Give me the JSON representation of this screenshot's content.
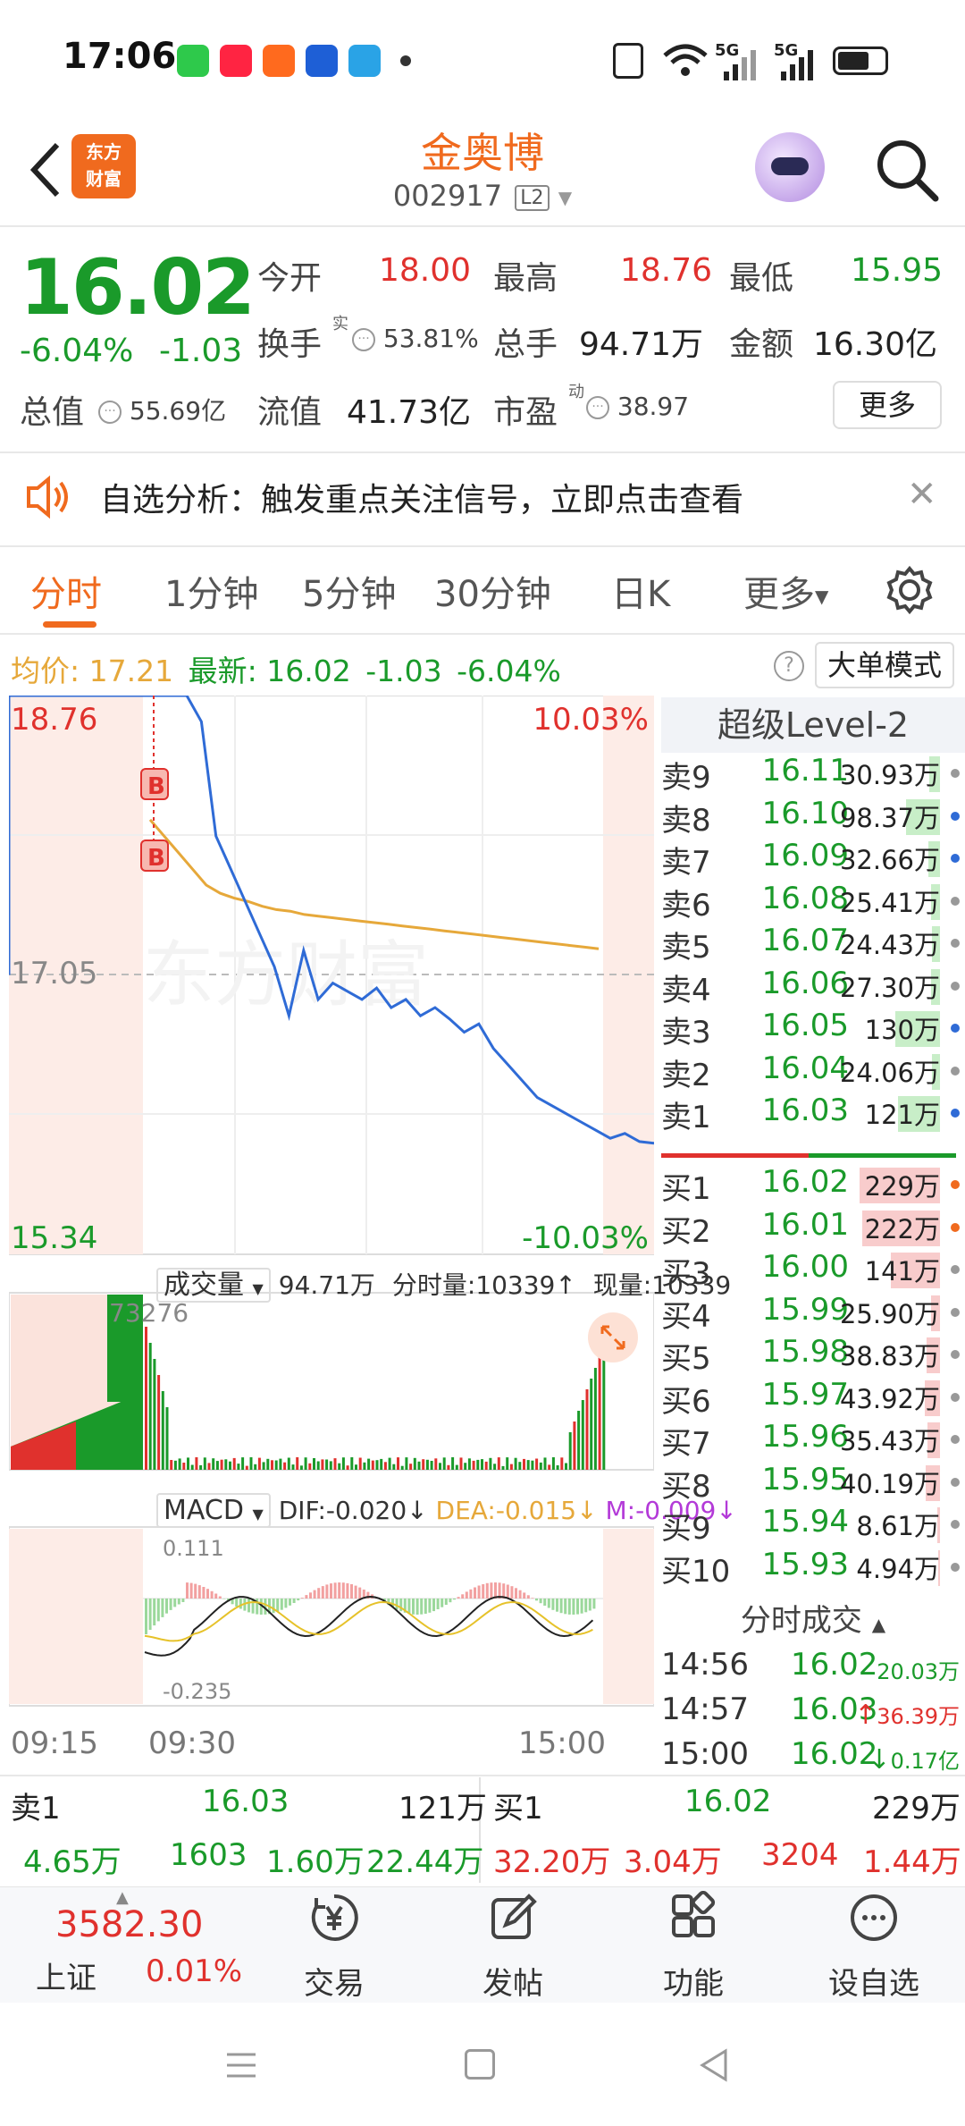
{
  "status_bar": {
    "time": "17:06",
    "network": "5G"
  },
  "header": {
    "back": "back",
    "logo_line1": "东方",
    "logo_line2": "财富",
    "stock_name": "金奥博",
    "stock_code": "002917",
    "level_badge": "L2"
  },
  "quote": {
    "price": "16.02",
    "change_pct": "-6.04%",
    "change_abs": "-1.03",
    "open_label": "今开",
    "open": "18.00",
    "high_label": "最高",
    "high": "18.76",
    "low_label": "最低",
    "low": "15.95",
    "turnover_label": "换手",
    "turnover_sup": "实",
    "turnover": "53.81%",
    "volume_label": "总手",
    "volume": "94.71万",
    "amount_label": "金额",
    "amount": "16.30亿",
    "mktcap_label": "总值",
    "mktcap": "55.69亿",
    "float_label": "流值",
    "float_cap": "41.73亿",
    "pe_label": "市盈",
    "pe_sup": "动",
    "pe": "38.97",
    "more_label": "更多"
  },
  "alert": {
    "text": "自选分析：触发重点关注信号，立即点击查看"
  },
  "tabs": [
    {
      "label": "分时"
    },
    {
      "label": "1分钟"
    },
    {
      "label": "5分钟"
    },
    {
      "label": "30分钟"
    },
    {
      "label": "日K"
    },
    {
      "label": "更多"
    }
  ],
  "avg_line": {
    "avg_label": "均价:",
    "avg": "17.21",
    "latest_label": "最新:",
    "latest": "16.02",
    "chg": "-1.03",
    "pct": "-6.04%",
    "big_order_mode": "大单模式"
  },
  "chart_data": {
    "type": "line",
    "price_top": "18.76",
    "price_mid": "17.05",
    "price_bottom": "15.34",
    "pct_top": "10.03%",
    "pct_bottom": "-10.03%",
    "ylim": [
      15.34,
      18.76
    ],
    "markers": [
      "B",
      "B"
    ],
    "price_series": [
      18.76,
      18.76,
      18.76,
      18.76,
      18.6,
      17.9,
      17.7,
      17.5,
      17.3,
      17.1,
      16.8,
      17.2,
      16.9,
      17.0,
      16.95,
      16.9,
      16.97,
      16.85,
      16.9,
      16.8,
      16.85,
      16.78,
      16.7,
      16.75,
      16.6,
      16.5,
      16.4,
      16.3,
      16.25,
      16.2,
      16.15,
      16.1,
      16.05,
      16.08,
      16.03,
      16.02
    ],
    "avg_series": [
      18.0,
      17.9,
      17.8,
      17.7,
      17.6,
      17.55,
      17.52,
      17.5,
      17.47,
      17.45,
      17.44,
      17.42,
      17.41,
      17.4,
      17.39,
      17.38,
      17.37,
      17.36,
      17.35,
      17.34,
      17.33,
      17.32,
      17.31,
      17.3,
      17.29,
      17.28,
      17.27,
      17.26,
      17.25,
      17.24,
      17.23,
      17.22,
      17.21
    ],
    "volume": {
      "label": "成交量",
      "total": "94.71万",
      "tick_label": "分时量:10339↑",
      "current_label": "现量:10339",
      "max_label": "73276"
    },
    "macd": {
      "label": "MACD",
      "dif": "DIF:-0.020↓",
      "dea": "DEA:-0.015↓",
      "m": "M:-0.009↓",
      "top": "0.111",
      "bottom": "-0.235"
    },
    "time_labels": [
      "09:15",
      "09:30",
      "15:00"
    ]
  },
  "order_book": {
    "title": "超级Level-2",
    "asks": [
      {
        "label": "卖9",
        "price": "16.11",
        "vol": "30.93万",
        "bar": 0.12,
        "dot": "#999"
      },
      {
        "label": "卖8",
        "price": "16.10",
        "vol": "98.37万",
        "bar": 0.38,
        "dot": "#2f6bd6"
      },
      {
        "label": "卖7",
        "price": "16.09",
        "vol": "32.66万",
        "bar": 0.13,
        "dot": "#2f6bd6"
      },
      {
        "label": "卖6",
        "price": "16.08",
        "vol": "25.41万",
        "bar": 0.1,
        "dot": "#999"
      },
      {
        "label": "卖5",
        "price": "16.07",
        "vol": "24.43万",
        "bar": 0.09,
        "dot": "#999"
      },
      {
        "label": "卖4",
        "price": "16.06",
        "vol": "27.30万",
        "bar": 0.1,
        "dot": "#999"
      },
      {
        "label": "卖3",
        "price": "16.05",
        "vol": "130万",
        "bar": 0.5,
        "dot": "#2f6bd6"
      },
      {
        "label": "卖2",
        "price": "16.04",
        "vol": "24.06万",
        "bar": 0.09,
        "dot": "#999"
      },
      {
        "label": "卖1",
        "price": "16.03",
        "vol": "121万",
        "bar": 0.47,
        "dot": "#2f6bd6"
      }
    ],
    "bids": [
      {
        "label": "买1",
        "price": "16.02",
        "vol": "229万",
        "bar": 0.9,
        "dot": "#f06a1e"
      },
      {
        "label": "买2",
        "price": "16.01",
        "vol": "222万",
        "bar": 0.87,
        "dot": "#f06a1e"
      },
      {
        "label": "买3",
        "price": "16.00",
        "vol": "141万",
        "bar": 0.55,
        "dot": "#999"
      },
      {
        "label": "买4",
        "price": "15.99",
        "vol": "25.90万",
        "bar": 0.1,
        "dot": "#999"
      },
      {
        "label": "买5",
        "price": "15.98",
        "vol": "38.83万",
        "bar": 0.15,
        "dot": "#999"
      },
      {
        "label": "买6",
        "price": "15.97",
        "vol": "43.92万",
        "bar": 0.17,
        "dot": "#999"
      },
      {
        "label": "买7",
        "price": "15.96",
        "vol": "35.43万",
        "bar": 0.14,
        "dot": "#999"
      },
      {
        "label": "买8",
        "price": "15.95",
        "vol": "40.19万",
        "bar": 0.16,
        "dot": "#999"
      },
      {
        "label": "买9",
        "price": "15.94",
        "vol": "8.61万",
        "bar": 0.03,
        "dot": "#999"
      },
      {
        "label": "买10",
        "price": "15.93",
        "vol": "4.94万",
        "bar": 0.02,
        "dot": "#999"
      }
    ]
  },
  "trades": {
    "title": "分时成交",
    "rows": [
      {
        "time": "14:56",
        "price": "16.02",
        "vol": "20.03万",
        "dir": ""
      },
      {
        "time": "14:57",
        "price": "16.03",
        "vol": "36.39万",
        "dir": "↑"
      },
      {
        "time": "15:00",
        "price": "16.02",
        "vol": "0.17亿",
        "dir": "↓"
      }
    ]
  },
  "strip": {
    "ask_label": "卖1",
    "ask_price": "16.03",
    "ask_vol": "121万",
    "bid_label": "买1",
    "bid_price": "16.02",
    "bid_vol": "229万",
    "row2": [
      "4.65万",
      "1603",
      "1.60万",
      "22.44万",
      "32.20万",
      "3.04万",
      "3204",
      "1.44万"
    ]
  },
  "bottom_nav": {
    "index_value": "3582.30",
    "index_name": "上证",
    "index_change": "0.01%",
    "items": [
      {
        "label": "交易",
        "icon": "yen-icon"
      },
      {
        "label": "发帖",
        "icon": "edit-icon"
      },
      {
        "label": "功能",
        "icon": "grid-icon"
      },
      {
        "label": "设自选",
        "icon": "more-dots-icon"
      }
    ]
  },
  "colors": {
    "accent": "#f06a1e",
    "up": "#e0312d",
    "down": "#1a9a2a",
    "price_line": "#2f6bd6",
    "avg_line": "#e6a83a"
  }
}
